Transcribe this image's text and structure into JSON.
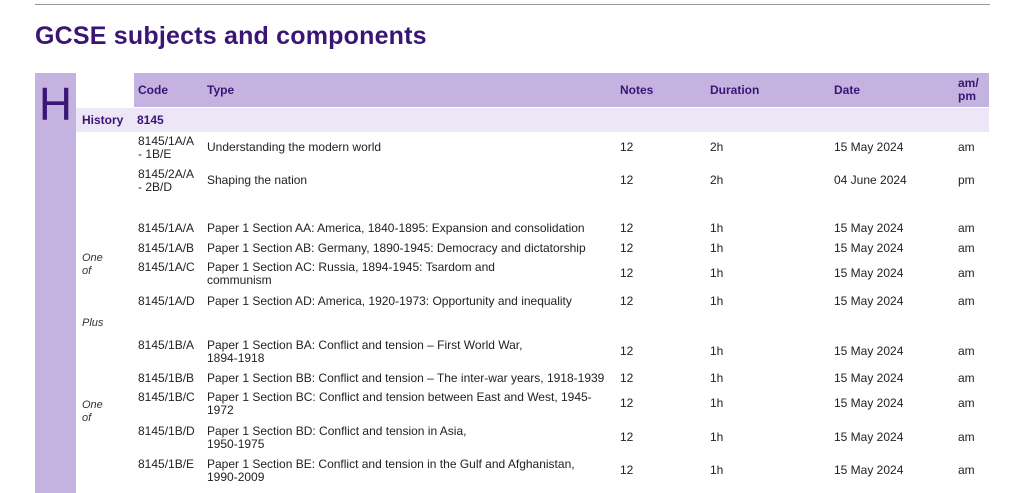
{
  "title": "GCSE subjects and components",
  "section_letter": "H",
  "headers": {
    "code": "Code",
    "type": "Type",
    "notes": "Notes",
    "duration": "Duration",
    "date": "Date",
    "ampm_1": "am/",
    "ampm_2": "pm"
  },
  "subject": {
    "name": "History",
    "code": "8145"
  },
  "groups": {
    "one_of": "One",
    "one_of_2": "of",
    "plus": "Plus"
  },
  "rows": [
    {
      "code1": "8145/1A/A",
      "code2": "- 1B/E",
      "type1": "Understanding the modern world",
      "type2": "",
      "notes": "12",
      "duration": "2h",
      "date": "15 May 2024",
      "ampm": "am"
    },
    {
      "code1": "8145/2A/A",
      "code2": "- 2B/D",
      "type1": "Shaping the nation",
      "type2": "",
      "notes": "12",
      "duration": "2h",
      "date": "04 June 2024",
      "ampm": "pm"
    },
    {
      "code1": "8145/1A/A",
      "code2": "",
      "type1": "Paper 1 Section AA: America, 1840-1895: Expansion and consolidation",
      "type2": "",
      "notes": "12",
      "duration": "1h",
      "date": "15 May 2024",
      "ampm": "am"
    },
    {
      "code1": "8145/1A/B",
      "code2": "",
      "type1": "Paper 1 Section AB: Germany, 1890-1945: Democracy and dictatorship",
      "type2": "",
      "notes": "12",
      "duration": "1h",
      "date": "15 May 2024",
      "ampm": "am"
    },
    {
      "code1": "8145/1A/C",
      "code2": "",
      "type1": "Paper 1 Section AC: Russia, 1894-1945: Tsardom and",
      "type2": "communism",
      "notes": "12",
      "duration": "1h",
      "date": "15 May 2024",
      "ampm": "am"
    },
    {
      "code1": "8145/1A/D",
      "code2": "",
      "type1": "Paper 1 Section AD: America, 1920-1973: Opportunity and inequality",
      "type2": "",
      "notes": "12",
      "duration": "1h",
      "date": "15 May 2024",
      "ampm": "am"
    },
    {
      "code1": "8145/1B/A",
      "code2": "",
      "type1": "Paper 1 Section BA: Conflict and tension – First World War,",
      "type2": "1894-1918",
      "notes": "12",
      "duration": "1h",
      "date": "15 May 2024",
      "ampm": "am"
    },
    {
      "code1": "8145/1B/B",
      "code2": "",
      "type1": "Paper 1 Section BB: Conflict and tension – The inter-war years, 1918-1939",
      "type2": "",
      "notes": "12",
      "duration": "1h",
      "date": "15 May 2024",
      "ampm": "am"
    },
    {
      "code1": "8145/1B/C",
      "code2": "",
      "type1": "Paper 1 Section BC: Conflict and tension between East and West, 1945-",
      "type2": "1972",
      "notes": "12",
      "duration": "1h",
      "date": "15 May 2024",
      "ampm": "am"
    },
    {
      "code1": "8145/1B/D",
      "code2": "",
      "type1": "Paper 1 Section BD: Conflict and tension in Asia,",
      "type2": "1950-1975",
      "notes": "12",
      "duration": "1h",
      "date": "15 May 2024",
      "ampm": "am"
    },
    {
      "code1": "8145/1B/E",
      "code2": "",
      "type1": "Paper 1 Section BE: Conflict and tension in the Gulf and Afghanistan,",
      "type2": "1990-2009",
      "notes": "12",
      "duration": "1h",
      "date": "15 May 2024",
      "ampm": "am"
    }
  ]
}
